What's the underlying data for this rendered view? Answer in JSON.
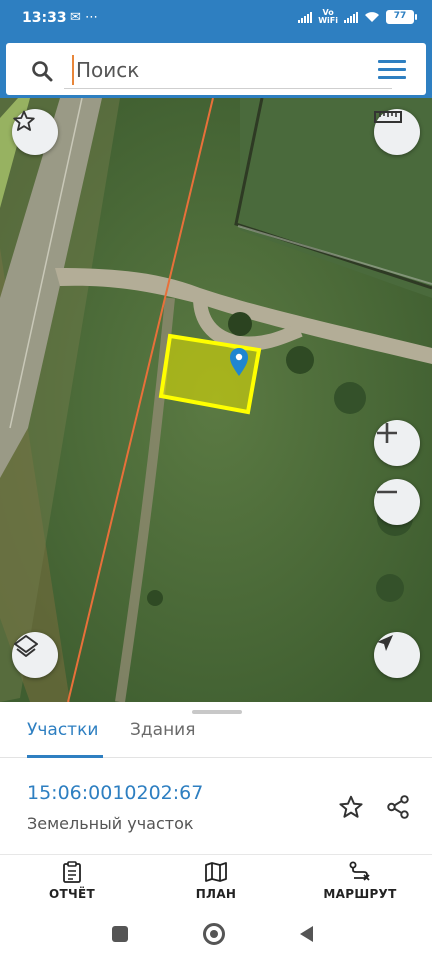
{
  "status_bar": {
    "time": "13:33",
    "volte_label": "Vo\nWiFi",
    "battery": "77"
  },
  "search": {
    "placeholder": "Поиск"
  },
  "bottom_sheet": {
    "tabs": [
      {
        "label": "Участки",
        "active": true
      },
      {
        "label": "Здания",
        "active": false
      }
    ],
    "parcel": {
      "cadastral_number": "15:06:0010202:67",
      "type": "Земельный участок"
    }
  },
  "bottom_nav": {
    "items": [
      {
        "label": "ОТЧЁТ",
        "icon": "report-icon"
      },
      {
        "label": "ПЛАН",
        "icon": "map-plan-icon"
      },
      {
        "label": "МАРШРУТ",
        "icon": "route-icon"
      }
    ]
  },
  "colors": {
    "primary": "#2e7fc1",
    "parcel_fill": "#e6e400",
    "parcel_border": "#ffff00",
    "boundary_line": "#e8703a"
  }
}
